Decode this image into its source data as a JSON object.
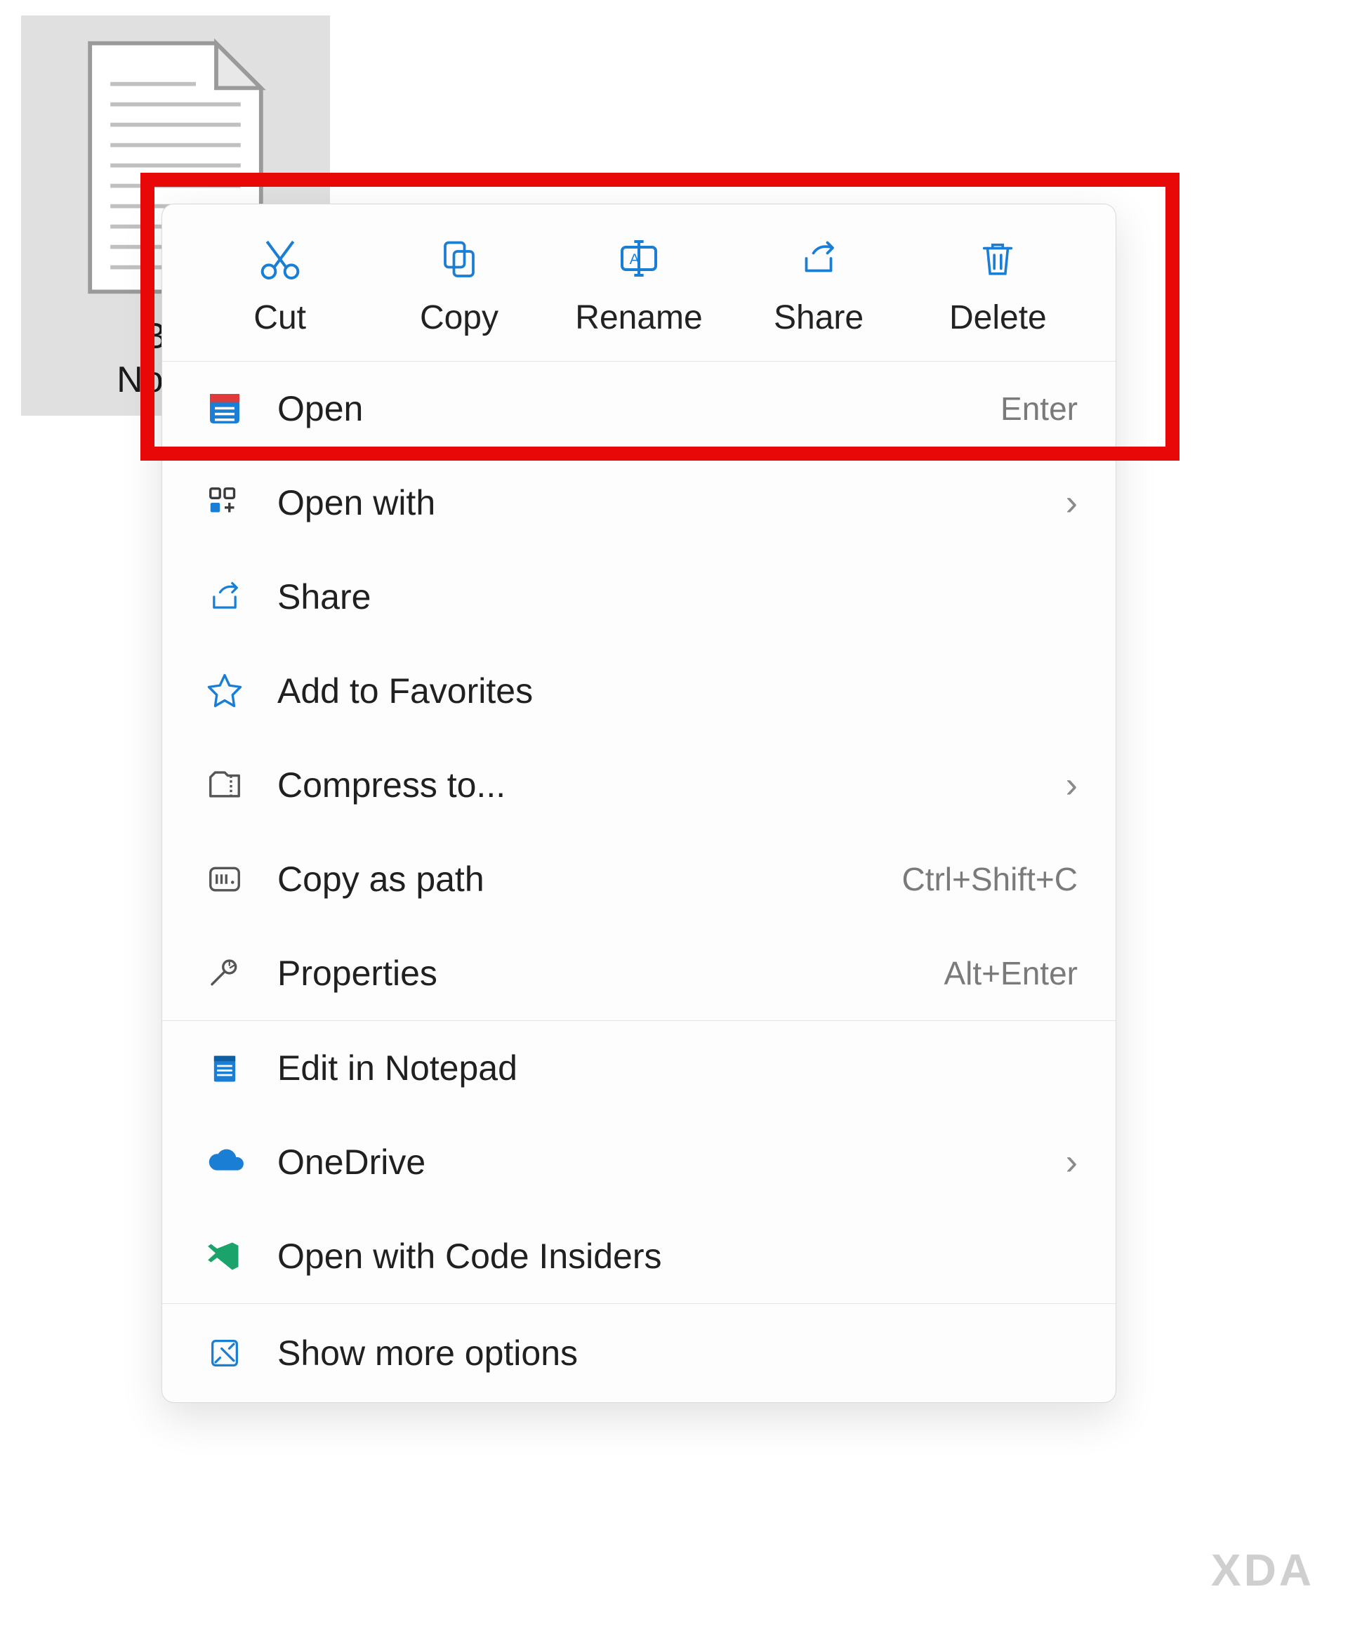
{
  "file": {
    "label": "Br n\nNotepa "
  },
  "actions": {
    "cut": "Cut",
    "copy": "Copy",
    "rename": "Rename",
    "share": "Share",
    "delete": "Delete"
  },
  "menu": {
    "open": {
      "label": "Open",
      "shortcut": "Enter"
    },
    "open_with": {
      "label": "Open with"
    },
    "share": {
      "label": "Share"
    },
    "favorites": {
      "label": "Add to Favorites"
    },
    "compress": {
      "label": "Compress to..."
    },
    "copy_path": {
      "label": "Copy as path",
      "shortcut": "Ctrl+Shift+C"
    },
    "properties": {
      "label": "Properties",
      "shortcut": "Alt+Enter"
    },
    "edit_notepad": {
      "label": "Edit in Notepad"
    },
    "onedrive": {
      "label": "OneDrive"
    },
    "code_insiders": {
      "label": "Open with Code Insiders"
    },
    "more_options": {
      "label": "Show more options"
    }
  },
  "watermark": "XDA"
}
